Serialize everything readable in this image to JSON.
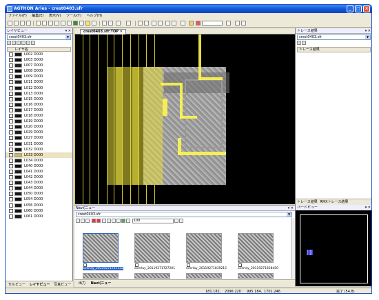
{
  "window": {
    "title": "AGTHON Aries - crest0403.sfr"
  },
  "menu": [
    "ファイル(F)",
    "編集(E)",
    "表示(V)",
    "ツール(T)",
    "ヘルプ(H)"
  ],
  "left_panel": {
    "title": "レイヤビュー",
    "file": "crest0403.sfr",
    "column_header": "レイヤ名",
    "layers": [
      {
        "name": "L002 D000",
        "color": "#1a1a1a"
      },
      {
        "name": "L003 D000",
        "color": "#111111"
      },
      {
        "name": "L007 D000",
        "color": "#222222"
      },
      {
        "name": "L008 D000",
        "color": "#0e0e0e"
      },
      {
        "name": "L009 D000",
        "color": "#191919"
      },
      {
        "name": "L011 D000",
        "color": "#202020"
      },
      {
        "name": "L012 D000",
        "color": "#151515"
      },
      {
        "name": "L013 D000",
        "color": "#1c1c1c"
      },
      {
        "name": "L015 D000",
        "color": "#111111"
      },
      {
        "name": "L016 D000",
        "color": "#181818"
      },
      {
        "name": "L017 D000",
        "color": "#1f1f1f"
      },
      {
        "name": "L018 D000",
        "color": "#121212"
      },
      {
        "name": "L019 D000",
        "color": "#1a1a1a"
      },
      {
        "name": "L020 D000",
        "color": "#141414"
      },
      {
        "name": "L029 D000",
        "color": "#1d1d1d"
      },
      {
        "name": "L027 D000",
        "color": "#101010"
      },
      {
        "name": "L031 D000",
        "color": "#191919"
      },
      {
        "name": "L032 D000",
        "color": "#131313"
      },
      {
        "name": "L033 D000",
        "color": "#c8b86a",
        "selected": true
      },
      {
        "name": "L034 D000",
        "color": "#1b1b1b"
      },
      {
        "name": "L040 D000",
        "color": "#0f0f0f"
      },
      {
        "name": "L041 D000",
        "color": "#1e1e1e"
      },
      {
        "name": "L042 D000",
        "color": "#121212"
      },
      {
        "name": "L043 D000",
        "color": "#1a1a1a"
      },
      {
        "name": "L044 D000",
        "color": "#161616"
      },
      {
        "name": "L050 D000",
        "color": "#1c1c1c"
      },
      {
        "name": "L054 D000",
        "color": "#101010"
      },
      {
        "name": "L056 D000",
        "color": "#191919"
      },
      {
        "name": "L060 D000",
        "color": "#141414"
      },
      {
        "name": "L061 D000",
        "color": "#1d1d1d"
      }
    ],
    "tabs": [
      "セルビュー",
      "レイヤビュー",
      "写真ビュー"
    ]
  },
  "image_view": {
    "tab": "crest0403.sfr:TOP"
  },
  "right_panel": {
    "title": "トレース結果",
    "file": "crest0403.sfr",
    "list_header": "トレース結果",
    "tabs": [
      "トレース結果",
      "RMXトレース結果"
    ]
  },
  "overview": {
    "title": "バードビュー"
  },
  "bottom_panel": {
    "title": "Navi(ニュー",
    "file": "crest0403.sfr",
    "zoom": "100",
    "thumbs": [
      {
        "label": "overlay_20119271727132",
        "selected": true
      },
      {
        "label": "overlay_20119271727201"
      },
      {
        "label": "overlay_20119271839215"
      },
      {
        "label": "overlay_20119271838450"
      }
    ],
    "tabs": [
      "出力",
      "Navi(ニュー"
    ]
  },
  "status": {
    "coord1": "181.182,",
    "coord2": "2096.220 :",
    "coord3": "995.184,",
    "coord4": "1701.246",
    "state": "完了 (54.8)"
  }
}
